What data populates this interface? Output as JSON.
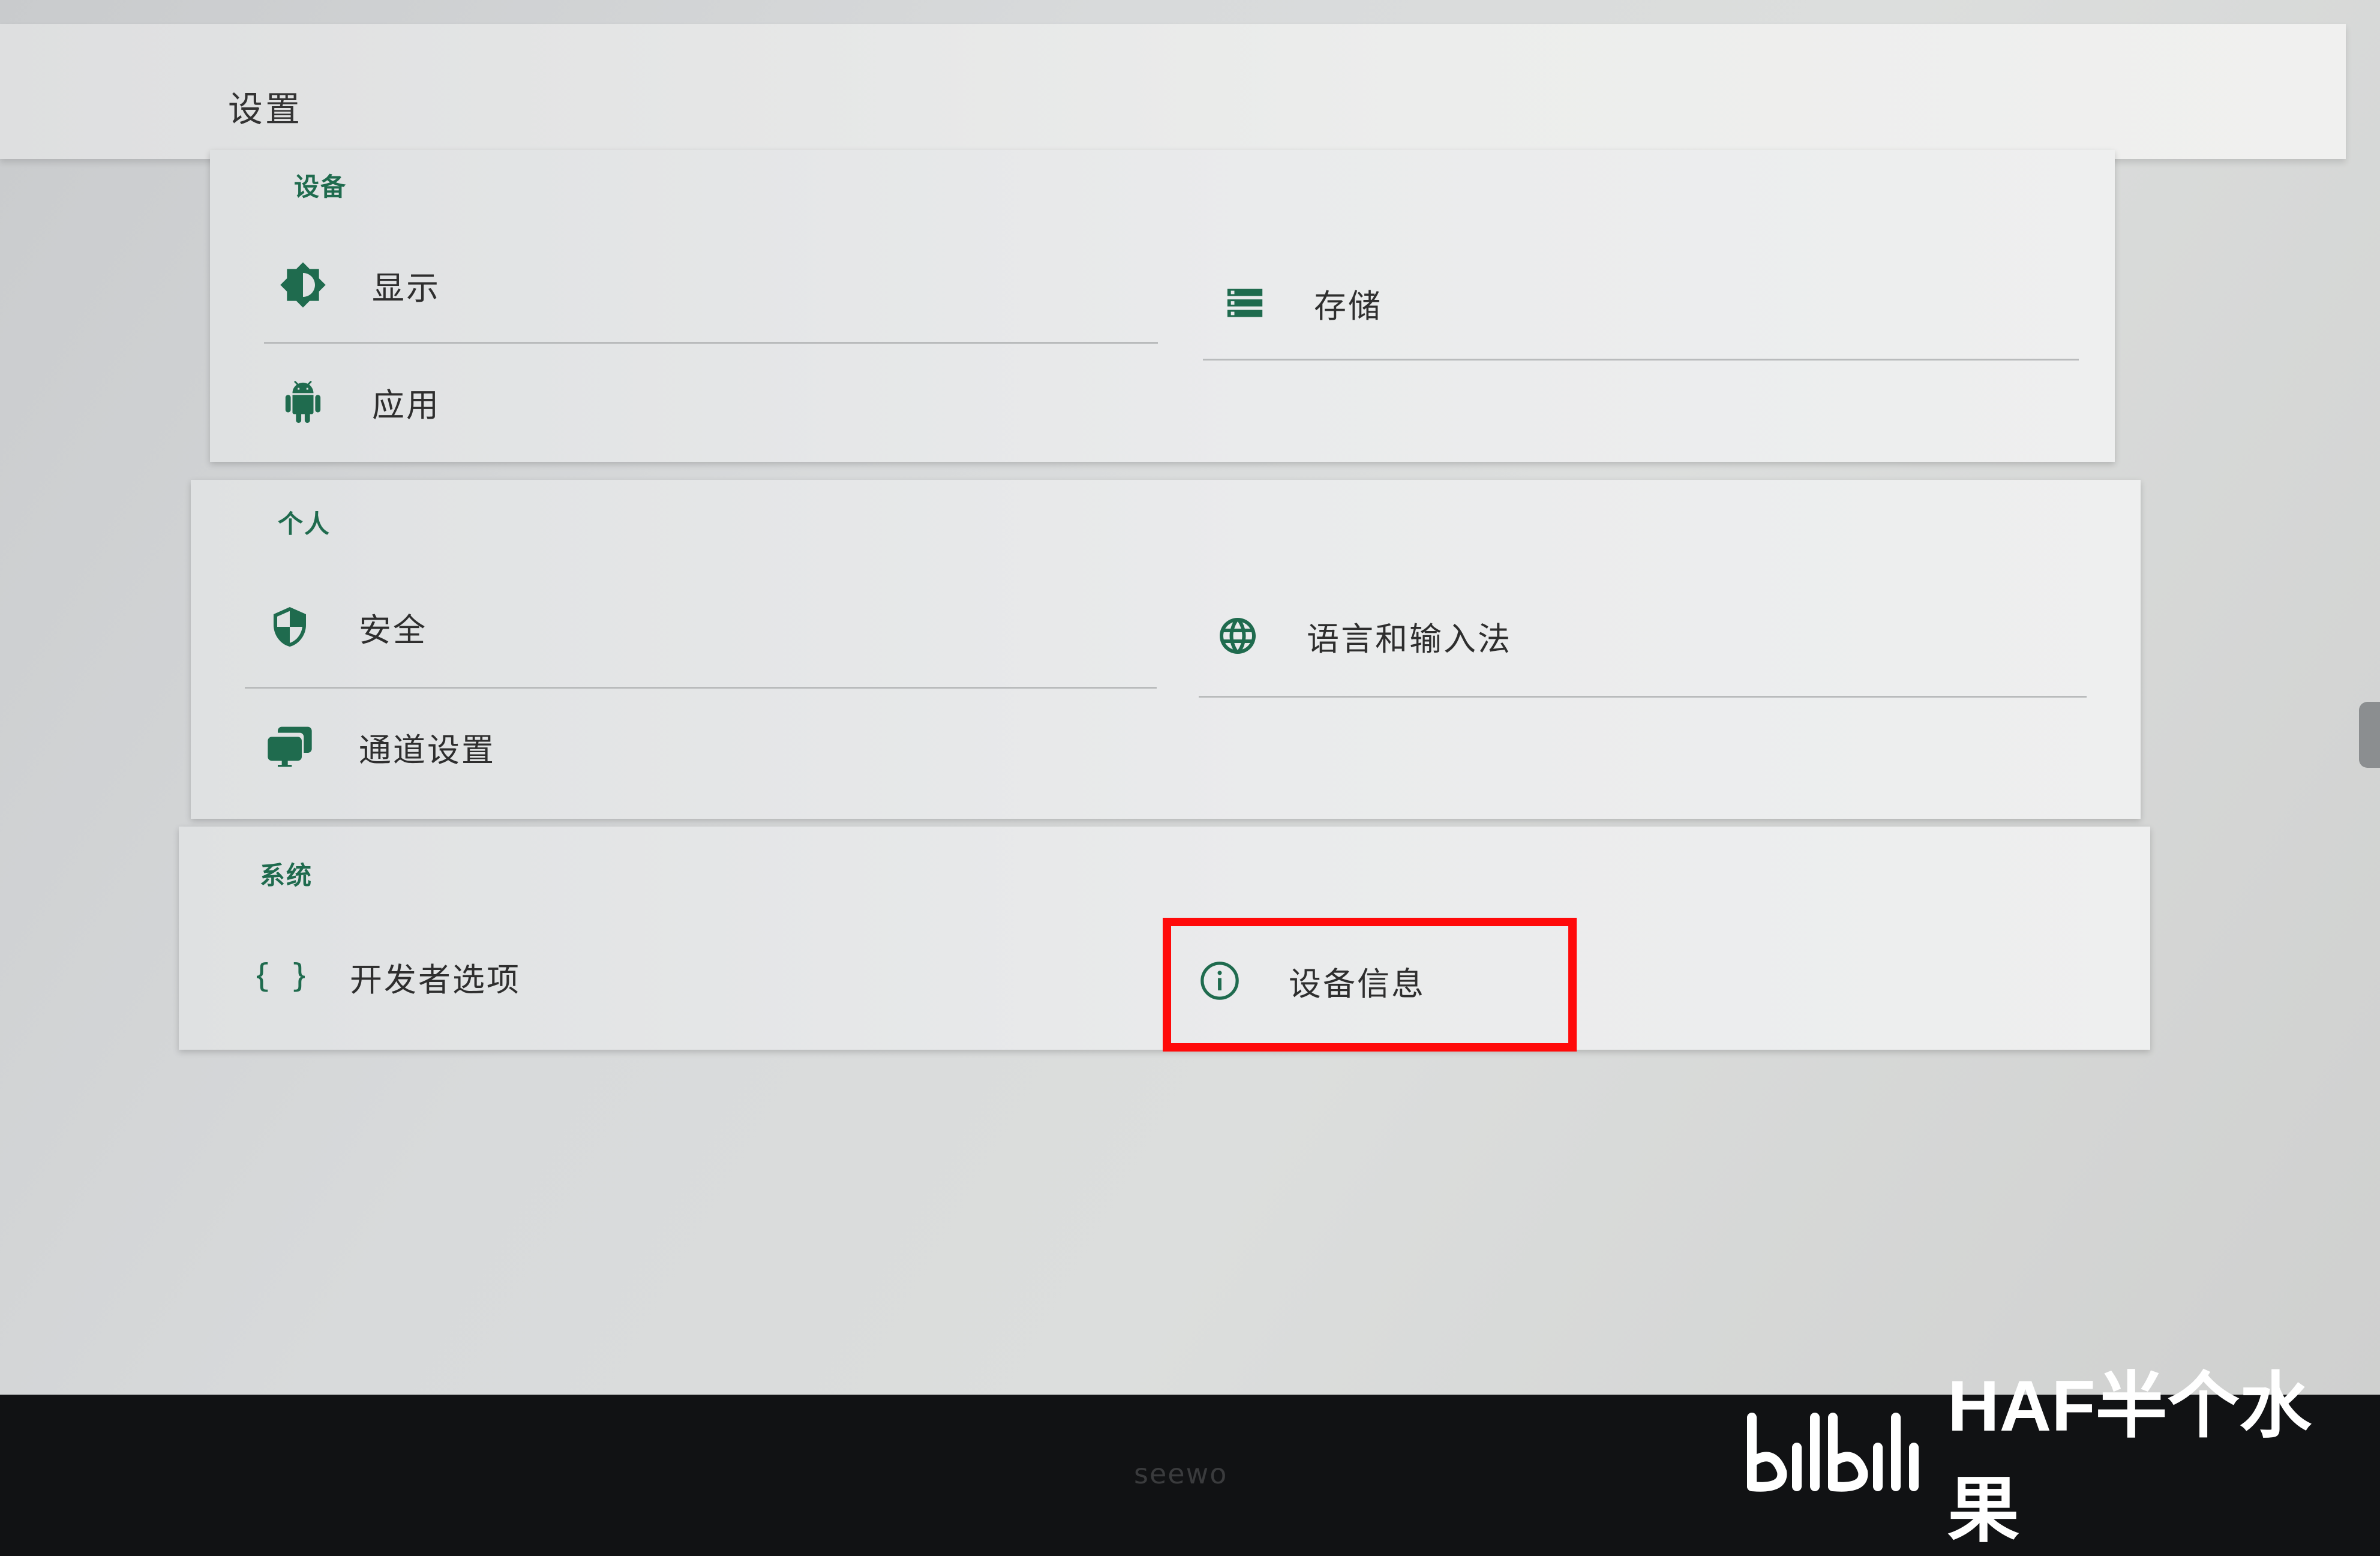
{
  "app": {
    "title": "设置"
  },
  "sections": {
    "device": {
      "title": "设备",
      "items": [
        {
          "label": "显示",
          "icon": "brightness-icon"
        },
        {
          "label": "存储",
          "icon": "storage-icon"
        },
        {
          "label": "应用",
          "icon": "android-icon"
        }
      ]
    },
    "personal": {
      "title": "个人",
      "items": [
        {
          "label": "安全",
          "icon": "shield-icon"
        },
        {
          "label": "语言和输入法",
          "icon": "globe-icon"
        },
        {
          "label": "通道设置",
          "icon": "monitor-icon"
        }
      ]
    },
    "system": {
      "title": "系统",
      "items": [
        {
          "label": "开发者选项",
          "icon": "braces-icon"
        },
        {
          "label": "设备信息",
          "icon": "info-icon"
        }
      ]
    }
  },
  "colors": {
    "accent": "#1f6b4e",
    "highlight": "#ff0a0a"
  },
  "bezel": {
    "brand": "seewo"
  },
  "watermark": {
    "text": "HAF半个水果"
  }
}
